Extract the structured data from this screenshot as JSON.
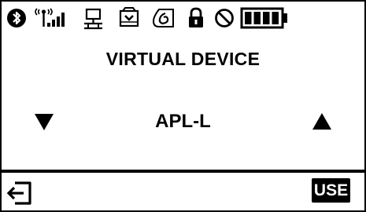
{
  "status_icons": [
    "bluetooth-icon",
    "wifi-signal-icon",
    "network-icon",
    "storage-icon",
    "nfc-icon",
    "lock-icon",
    "blocked-icon",
    "battery-icon"
  ],
  "battery": {
    "level": 1.0
  },
  "screen": {
    "title": "VIRTUAL DEVICE",
    "value": "APL-L"
  },
  "soft_keys": {
    "left_icon": "back-icon",
    "right_label": "USE"
  },
  "colors": {
    "foreground": "#000000",
    "background": "#ffffff"
  }
}
